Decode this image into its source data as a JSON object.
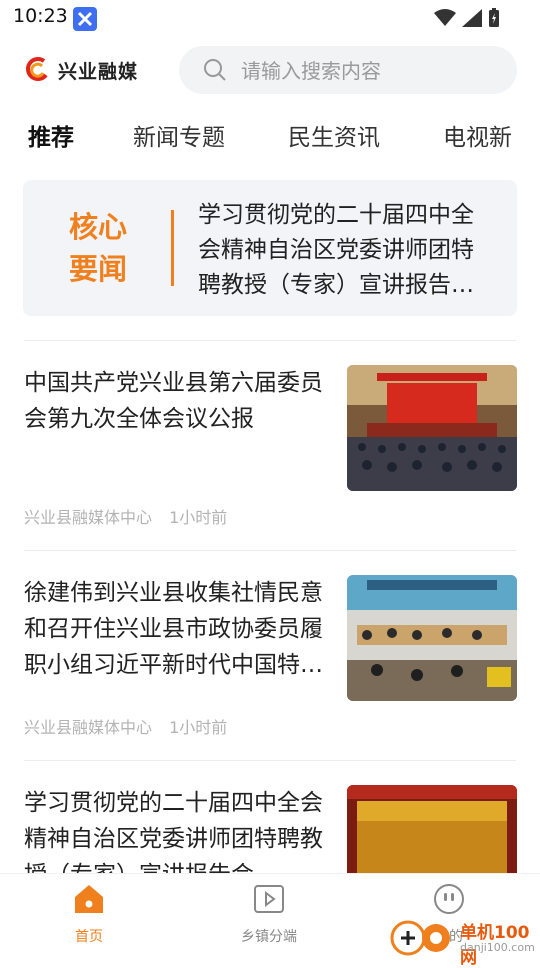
{
  "status_bar": {
    "time": "10:23"
  },
  "header": {
    "app_name": "兴业融媒",
    "search_placeholder": "请输入搜索内容"
  },
  "tabs": [
    {
      "label": "推荐",
      "active": true
    },
    {
      "label": "新闻专题",
      "active": false
    },
    {
      "label": "民生资讯",
      "active": false
    },
    {
      "label": "电视新",
      "active": false
    }
  ],
  "headline": {
    "badge_line1": "核心",
    "badge_line2": "要闻",
    "text": "学习贯彻党的二十届四中全会精神自治区党委讲师团特聘教授（专家）宣讲报告会在兴业县举行"
  },
  "news": [
    {
      "title": "中国共产党兴业县第六届委员会第九次全体会议公报",
      "source": "兴业县融媒体中心",
      "time": "1小时前"
    },
    {
      "title": "徐建伟到兴业县收集社情民意和召开住兴业县市政协委员履职小组习近平新时代中国特色社会主义思想学习座谈会",
      "source": "兴业县融媒体中心",
      "time": "1小时前"
    },
    {
      "title": "学习贯彻党的二十届四中全会精神自治区党委讲师团特聘教授（专家）宣讲报告会",
      "source": "",
      "time": ""
    }
  ],
  "bottom_nav": [
    {
      "label": "首页",
      "icon": "home-icon",
      "active": true
    },
    {
      "label": "乡镇分端",
      "icon": "video-icon",
      "active": false
    },
    {
      "label": "我的",
      "icon": "profile-icon",
      "active": false
    }
  ],
  "watermark": {
    "text": "单机100网",
    "url": "danji100.com"
  },
  "colors": {
    "accent": "#f07f1d",
    "headline_bg": "#f2f4f8"
  }
}
